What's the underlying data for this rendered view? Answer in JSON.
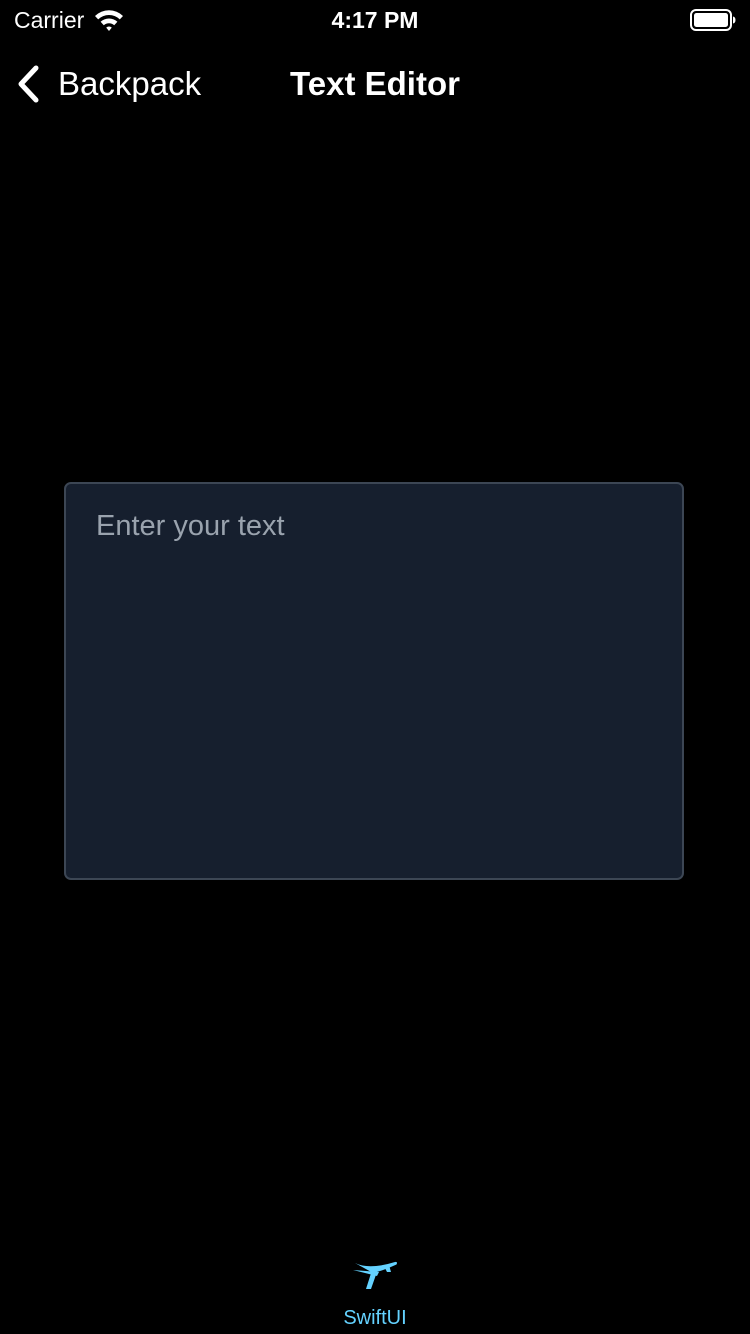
{
  "status_bar": {
    "carrier": "Carrier",
    "time": "4:17 PM",
    "wifi_icon": "wifi-icon",
    "battery_icon": "battery-full-icon"
  },
  "nav": {
    "back_label": "Backpack",
    "back_icon": "chevron-left-icon",
    "title": "Text Editor"
  },
  "editor": {
    "placeholder": "Enter your text",
    "value": ""
  },
  "tab_bar": {
    "items": [
      {
        "label": "SwiftUI",
        "icon": "airplane-icon",
        "selected": true
      }
    ]
  },
  "colors": {
    "background": "#000000",
    "editor_background": "#161f2e",
    "editor_border": "#3c4654",
    "placeholder_text": "#9aa3ae",
    "tab_accent": "#64d2ff"
  }
}
